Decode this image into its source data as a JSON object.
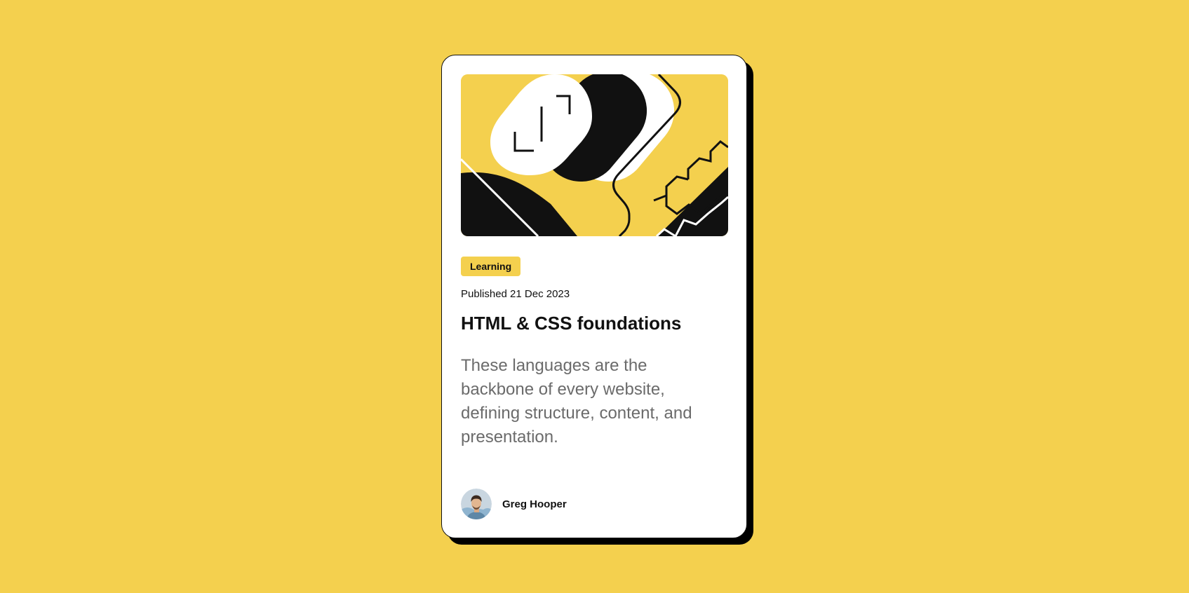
{
  "card": {
    "tag": "Learning",
    "published": "Published 21 Dec 2023",
    "title": "HTML & CSS foundations",
    "excerpt": "These languages are the backbone of every website, defining structure, content, and presentation.",
    "author": {
      "name": "Greg Hooper"
    }
  },
  "colors": {
    "background": "#F4D04E",
    "card": "#FFFFFF",
    "ink": "#111111",
    "muted_text": "#6B6B6B",
    "tag": "#F4D04E"
  }
}
